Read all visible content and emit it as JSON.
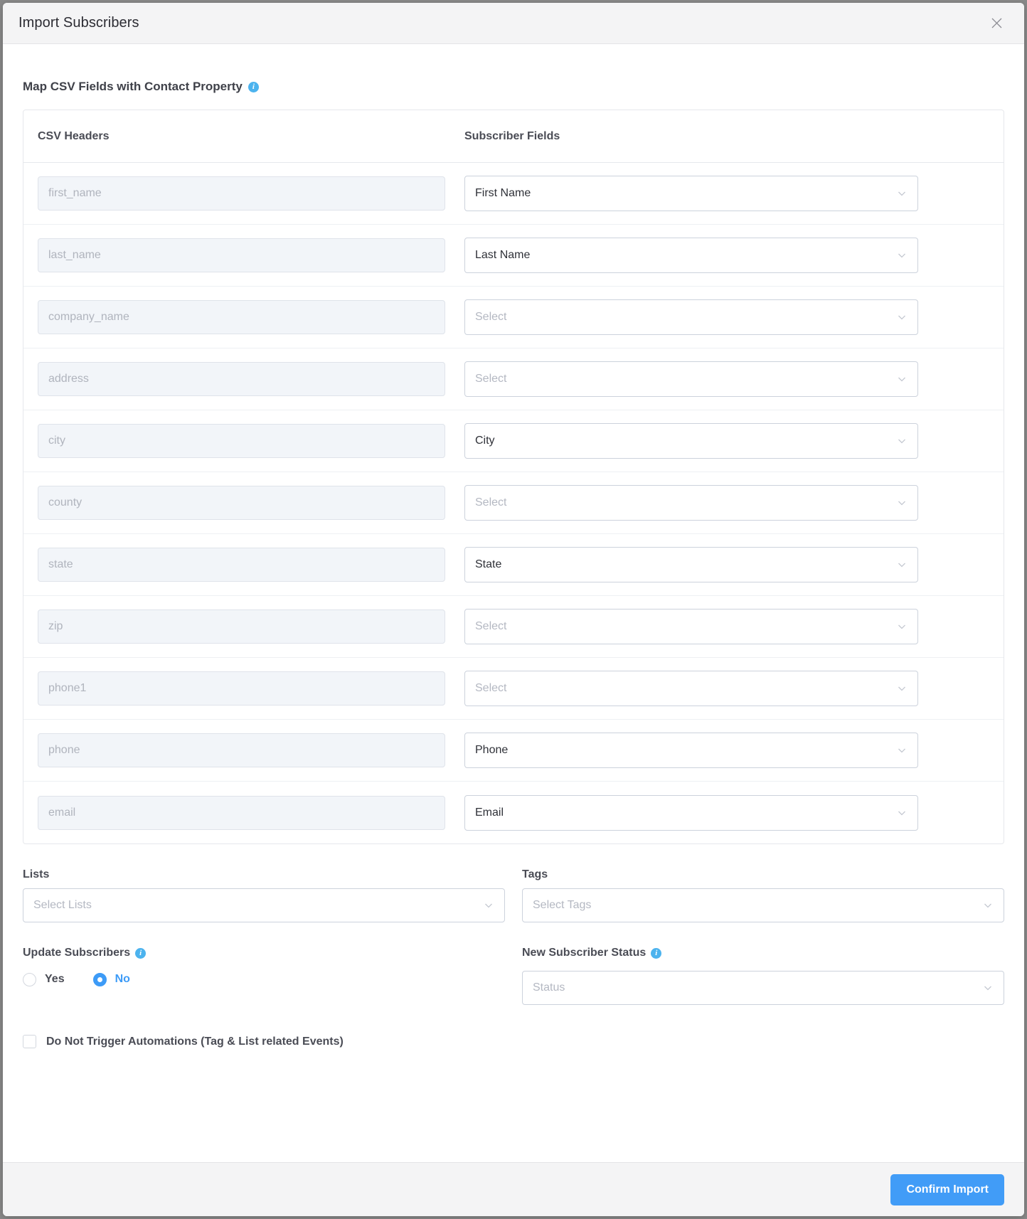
{
  "modal": {
    "title": "Import Subscribers",
    "close_icon": "close-icon"
  },
  "section": {
    "heading": "Map CSV Fields with Contact Property",
    "info_icon": "info-icon"
  },
  "table": {
    "headers": {
      "csv": "CSV Headers",
      "subscriber": "Subscriber Fields"
    },
    "rows": [
      {
        "csv_header": "first_name",
        "subscriber_field": "First Name",
        "is_placeholder": false
      },
      {
        "csv_header": "last_name",
        "subscriber_field": "Last Name",
        "is_placeholder": false
      },
      {
        "csv_header": "company_name",
        "subscriber_field": "Select",
        "is_placeholder": true
      },
      {
        "csv_header": "address",
        "subscriber_field": "Select",
        "is_placeholder": true
      },
      {
        "csv_header": "city",
        "subscriber_field": "City",
        "is_placeholder": false
      },
      {
        "csv_header": "county",
        "subscriber_field": "Select",
        "is_placeholder": true
      },
      {
        "csv_header": "state",
        "subscriber_field": "State",
        "is_placeholder": false
      },
      {
        "csv_header": "zip",
        "subscriber_field": "Select",
        "is_placeholder": true
      },
      {
        "csv_header": "phone1",
        "subscriber_field": "Select",
        "is_placeholder": true
      },
      {
        "csv_header": "phone",
        "subscriber_field": "Phone",
        "is_placeholder": false
      },
      {
        "csv_header": "email",
        "subscriber_field": "Email",
        "is_placeholder": false
      }
    ]
  },
  "form": {
    "lists": {
      "label": "Lists",
      "placeholder": "Select Lists",
      "value": ""
    },
    "tags": {
      "label": "Tags",
      "placeholder": "Select Tags",
      "value": ""
    },
    "update_subscribers": {
      "label": "Update Subscribers",
      "options": [
        {
          "label": "Yes",
          "selected": false
        },
        {
          "label": "No",
          "selected": true
        }
      ]
    },
    "new_subscriber_status": {
      "label": "New Subscriber Status",
      "placeholder": "Status",
      "value": ""
    },
    "do_not_trigger": {
      "label": "Do Not Trigger Automations (Tag & List related Events)",
      "checked": false
    }
  },
  "footer": {
    "confirm_label": "Confirm Import"
  },
  "colors": {
    "accent": "#419cf7",
    "info": "#4cb3ee",
    "header_bg": "#f4f4f5",
    "input_bg": "#f2f5f9",
    "border": "#ccd2dc"
  }
}
